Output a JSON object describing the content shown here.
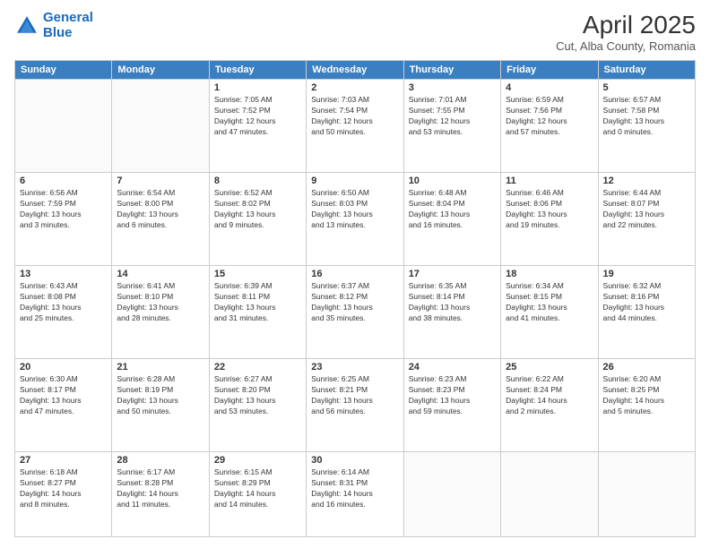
{
  "header": {
    "logo_line1": "General",
    "logo_line2": "Blue",
    "month": "April 2025",
    "location": "Cut, Alba County, Romania"
  },
  "weekdays": [
    "Sunday",
    "Monday",
    "Tuesday",
    "Wednesday",
    "Thursday",
    "Friday",
    "Saturday"
  ],
  "weeks": [
    [
      {
        "day": "",
        "info": ""
      },
      {
        "day": "",
        "info": ""
      },
      {
        "day": "1",
        "info": "Sunrise: 7:05 AM\nSunset: 7:52 PM\nDaylight: 12 hours\nand 47 minutes."
      },
      {
        "day": "2",
        "info": "Sunrise: 7:03 AM\nSunset: 7:54 PM\nDaylight: 12 hours\nand 50 minutes."
      },
      {
        "day": "3",
        "info": "Sunrise: 7:01 AM\nSunset: 7:55 PM\nDaylight: 12 hours\nand 53 minutes."
      },
      {
        "day": "4",
        "info": "Sunrise: 6:59 AM\nSunset: 7:56 PM\nDaylight: 12 hours\nand 57 minutes."
      },
      {
        "day": "5",
        "info": "Sunrise: 6:57 AM\nSunset: 7:58 PM\nDaylight: 13 hours\nand 0 minutes."
      }
    ],
    [
      {
        "day": "6",
        "info": "Sunrise: 6:56 AM\nSunset: 7:59 PM\nDaylight: 13 hours\nand 3 minutes."
      },
      {
        "day": "7",
        "info": "Sunrise: 6:54 AM\nSunset: 8:00 PM\nDaylight: 13 hours\nand 6 minutes."
      },
      {
        "day": "8",
        "info": "Sunrise: 6:52 AM\nSunset: 8:02 PM\nDaylight: 13 hours\nand 9 minutes."
      },
      {
        "day": "9",
        "info": "Sunrise: 6:50 AM\nSunset: 8:03 PM\nDaylight: 13 hours\nand 13 minutes."
      },
      {
        "day": "10",
        "info": "Sunrise: 6:48 AM\nSunset: 8:04 PM\nDaylight: 13 hours\nand 16 minutes."
      },
      {
        "day": "11",
        "info": "Sunrise: 6:46 AM\nSunset: 8:06 PM\nDaylight: 13 hours\nand 19 minutes."
      },
      {
        "day": "12",
        "info": "Sunrise: 6:44 AM\nSunset: 8:07 PM\nDaylight: 13 hours\nand 22 minutes."
      }
    ],
    [
      {
        "day": "13",
        "info": "Sunrise: 6:43 AM\nSunset: 8:08 PM\nDaylight: 13 hours\nand 25 minutes."
      },
      {
        "day": "14",
        "info": "Sunrise: 6:41 AM\nSunset: 8:10 PM\nDaylight: 13 hours\nand 28 minutes."
      },
      {
        "day": "15",
        "info": "Sunrise: 6:39 AM\nSunset: 8:11 PM\nDaylight: 13 hours\nand 31 minutes."
      },
      {
        "day": "16",
        "info": "Sunrise: 6:37 AM\nSunset: 8:12 PM\nDaylight: 13 hours\nand 35 minutes."
      },
      {
        "day": "17",
        "info": "Sunrise: 6:35 AM\nSunset: 8:14 PM\nDaylight: 13 hours\nand 38 minutes."
      },
      {
        "day": "18",
        "info": "Sunrise: 6:34 AM\nSunset: 8:15 PM\nDaylight: 13 hours\nand 41 minutes."
      },
      {
        "day": "19",
        "info": "Sunrise: 6:32 AM\nSunset: 8:16 PM\nDaylight: 13 hours\nand 44 minutes."
      }
    ],
    [
      {
        "day": "20",
        "info": "Sunrise: 6:30 AM\nSunset: 8:17 PM\nDaylight: 13 hours\nand 47 minutes."
      },
      {
        "day": "21",
        "info": "Sunrise: 6:28 AM\nSunset: 8:19 PM\nDaylight: 13 hours\nand 50 minutes."
      },
      {
        "day": "22",
        "info": "Sunrise: 6:27 AM\nSunset: 8:20 PM\nDaylight: 13 hours\nand 53 minutes."
      },
      {
        "day": "23",
        "info": "Sunrise: 6:25 AM\nSunset: 8:21 PM\nDaylight: 13 hours\nand 56 minutes."
      },
      {
        "day": "24",
        "info": "Sunrise: 6:23 AM\nSunset: 8:23 PM\nDaylight: 13 hours\nand 59 minutes."
      },
      {
        "day": "25",
        "info": "Sunrise: 6:22 AM\nSunset: 8:24 PM\nDaylight: 14 hours\nand 2 minutes."
      },
      {
        "day": "26",
        "info": "Sunrise: 6:20 AM\nSunset: 8:25 PM\nDaylight: 14 hours\nand 5 minutes."
      }
    ],
    [
      {
        "day": "27",
        "info": "Sunrise: 6:18 AM\nSunset: 8:27 PM\nDaylight: 14 hours\nand 8 minutes."
      },
      {
        "day": "28",
        "info": "Sunrise: 6:17 AM\nSunset: 8:28 PM\nDaylight: 14 hours\nand 11 minutes."
      },
      {
        "day": "29",
        "info": "Sunrise: 6:15 AM\nSunset: 8:29 PM\nDaylight: 14 hours\nand 14 minutes."
      },
      {
        "day": "30",
        "info": "Sunrise: 6:14 AM\nSunset: 8:31 PM\nDaylight: 14 hours\nand 16 minutes."
      },
      {
        "day": "",
        "info": ""
      },
      {
        "day": "",
        "info": ""
      },
      {
        "day": "",
        "info": ""
      }
    ]
  ]
}
